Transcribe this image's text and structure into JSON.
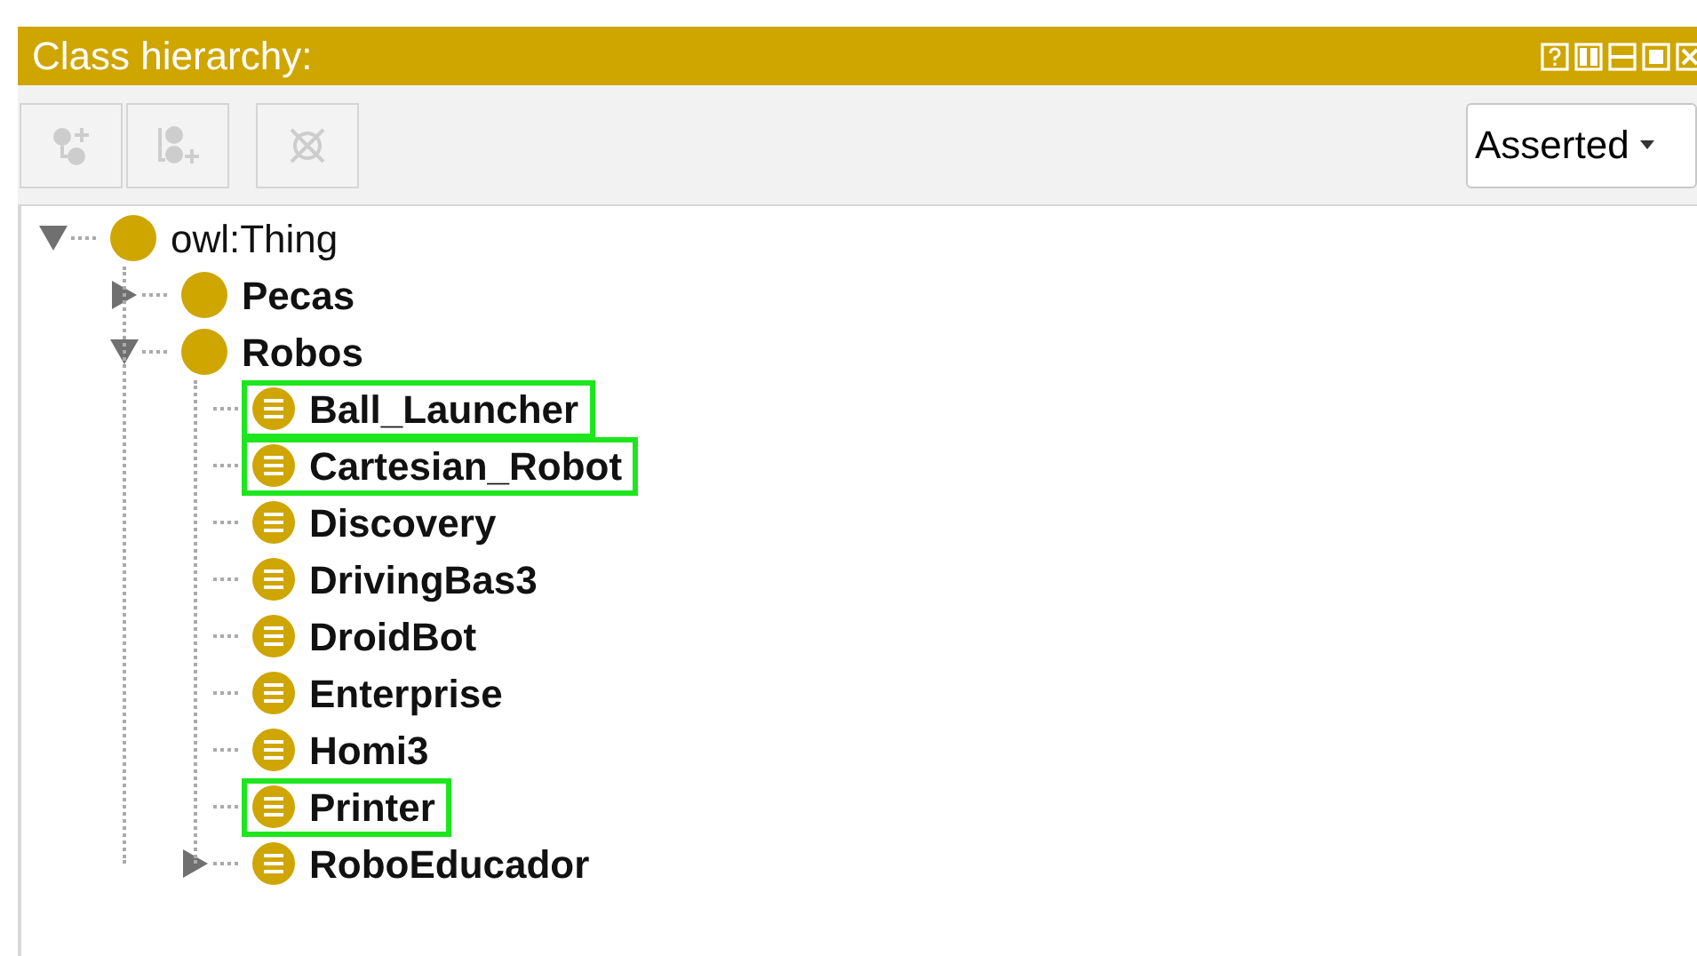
{
  "panel": {
    "title": "Class hierarchy:"
  },
  "toolbar": {
    "buttons": [
      {
        "kind": "add-subclass",
        "disabled": true
      },
      {
        "kind": "add-sibling",
        "disabled": true
      },
      {
        "kind": "delete",
        "disabled": true
      }
    ],
    "dropdown": {
      "value": "Asserted"
    }
  },
  "tree": [
    {
      "label": "owl:Thing",
      "kind": "root",
      "expanded": true,
      "highlighted": false,
      "children": [
        {
          "label": "Pecas",
          "kind": "class",
          "expanded": false,
          "highlighted": false
        },
        {
          "label": "Robos",
          "kind": "class",
          "expanded": true,
          "highlighted": false,
          "children": [
            {
              "label": "Ball_Launcher",
              "kind": "defined",
              "highlighted": true
            },
            {
              "label": "Cartesian_Robot",
              "kind": "defined",
              "highlighted": true
            },
            {
              "label": "Discovery",
              "kind": "defined",
              "highlighted": false
            },
            {
              "label": "DrivingBas3",
              "kind": "defined",
              "highlighted": false
            },
            {
              "label": "DroidBot",
              "kind": "defined",
              "highlighted": false
            },
            {
              "label": "Enterprise",
              "kind": "defined",
              "highlighted": false
            },
            {
              "label": "Homi3",
              "kind": "defined",
              "highlighted": false
            },
            {
              "label": "Printer",
              "kind": "defined",
              "highlighted": true
            },
            {
              "label": "RoboEducador",
              "kind": "defined",
              "expanded": false,
              "highlighted": false
            }
          ]
        }
      ]
    }
  ]
}
